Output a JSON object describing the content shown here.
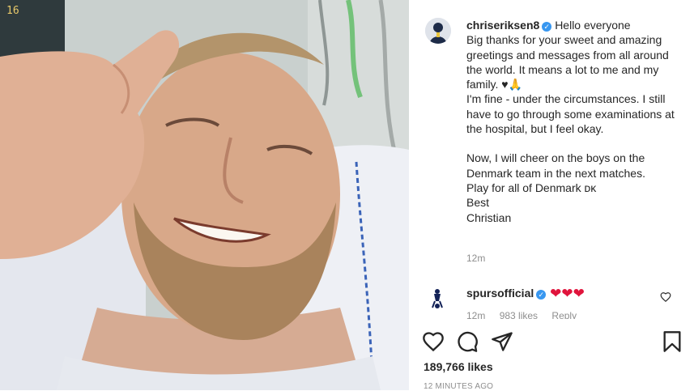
{
  "photo": {
    "monitor_text": "16"
  },
  "caption": {
    "username": "chriseriksen8",
    "first_line": "Hello everyone",
    "lines": [
      "Big thanks for your sweet and amazing greetings and messages from all around the world. It means a lot to me and my family. ♥🙏",
      "I'm fine - under the circumstances. I still have to go through some examinations at the hospital, but I feel okay."
    ],
    "lines2": [
      "Now, I will cheer on the boys on the Denmark team in the next matches.",
      "Play for all of Denmark ᴅᴋ",
      "Best",
      "Christian"
    ],
    "time": "12m"
  },
  "comment": {
    "username": "spursofficial",
    "text": "❤❤❤",
    "meta_time": "12m",
    "meta_likes": "983 likes",
    "meta_reply": "Reply"
  },
  "post": {
    "likes": "189,766 likes",
    "ago": "12 MINUTES AGO"
  },
  "icons": {
    "like": "heart-icon",
    "comment": "comment-icon",
    "share": "paper-plane-icon",
    "save": "bookmark-icon",
    "verified": "verified-badge-icon"
  },
  "colors": {
    "verified": "#3897f0",
    "heart": "#e0143c",
    "text": "#262626",
    "muted": "#8e8e8e"
  }
}
